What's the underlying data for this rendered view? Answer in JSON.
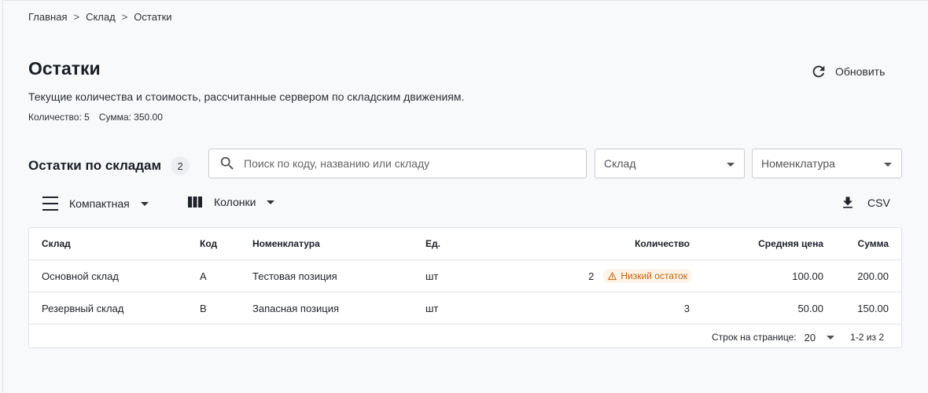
{
  "breadcrumb": [
    "Главная",
    "Склад",
    "Остатки"
  ],
  "breadcrumb_separator": ">",
  "header": {
    "title": "Остатки",
    "refresh_label": "Обновить",
    "description": "Текущие количества и стоимость, рассчитанные сервером по складским движениям.",
    "totals": {
      "quantity": "Количество: 5",
      "sum": "Сумма: 350.00"
    }
  },
  "section": {
    "title": "Остатки по складам",
    "count": "2",
    "search_placeholder": "Поиск по коду, названию или складу",
    "filter_warehouse": "Склад",
    "filter_nomenclature": "Номенклатура"
  },
  "toolbar": {
    "density_label": "Компактная",
    "columns_label": "Колонки",
    "export_label": "CSV"
  },
  "table": {
    "headers": [
      "Склад",
      "Код",
      "Номенклатура",
      "Ед.",
      "Количество",
      "Средняя цена",
      "Сумма"
    ],
    "rows": [
      [
        "Основной склад",
        "A",
        "Тестовая позиция",
        "шт",
        "2",
        "100.00",
        "200.00"
      ],
      [
        "Резервный склад",
        "B",
        "Запасная позиция",
        "шт",
        "3",
        "50.00",
        "150.00"
      ]
    ],
    "low_stock_label": "Низкий остаток"
  },
  "pagination": {
    "rows_per_page_label": "Строк на странице:",
    "rows_per_page": "20",
    "range": "1-2 из 2"
  },
  "colors": {
    "warning": "#c4620c",
    "warning_bg": "#fdf3e7"
  }
}
